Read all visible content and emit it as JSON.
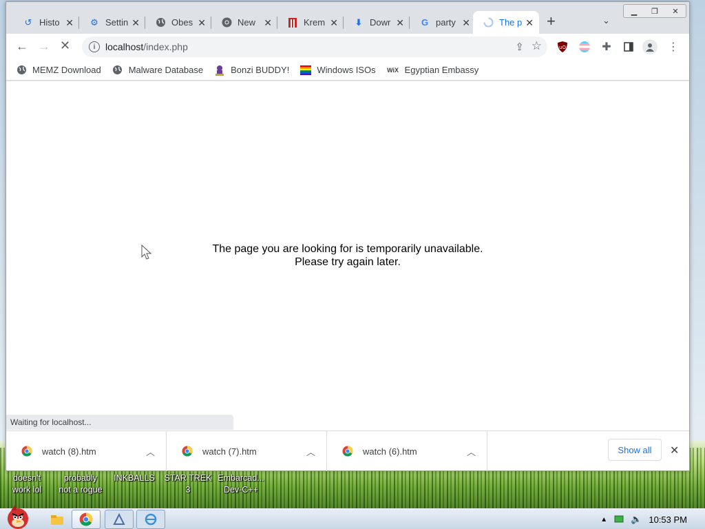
{
  "desktop": {
    "icons": [
      {
        "label": "doesn't\nwork lol"
      },
      {
        "label": "probably\nnot a rogue"
      },
      {
        "label": "INKBALLS"
      },
      {
        "label": "STAR TREK\n3"
      },
      {
        "label": "Embarcad...\nDev-C++"
      }
    ]
  },
  "tabs": [
    {
      "label": "Histo",
      "icon": "history-icon"
    },
    {
      "label": "Settin",
      "icon": "settings-icon"
    },
    {
      "label": "Obes",
      "icon": "globe-icon"
    },
    {
      "label": "New",
      "icon": "chrome-icon"
    },
    {
      "label": "Krem",
      "icon": "kremlin-icon"
    },
    {
      "label": "Dowr",
      "icon": "download-icon"
    },
    {
      "label": "party",
      "icon": "google-icon"
    },
    {
      "label": "The p",
      "icon": "loading-icon",
      "active": true
    }
  ],
  "omnibox": {
    "host": "localhost",
    "path": "/index.php"
  },
  "bookmarks": [
    {
      "label": "MEMZ Download",
      "icon": "globe-icon"
    },
    {
      "label": "Malware Database",
      "icon": "globe-icon"
    },
    {
      "label": "Bonzi BUDDY!",
      "icon": "bonzi-icon"
    },
    {
      "label": "Windows ISOs",
      "icon": "rainbow-flag-icon"
    },
    {
      "label": "Egyptian Embassy",
      "icon": "wix-icon"
    }
  ],
  "wix_text": "WiX",
  "page": {
    "line1": "The page you are looking for is temporarily unavailable.",
    "line2": "Please try again later."
  },
  "status": "Waiting for localhost...",
  "downloads": [
    {
      "name": "watch (8).htm"
    },
    {
      "name": "watch (7).htm"
    },
    {
      "name": "watch (6).htm"
    }
  ],
  "show_all": "Show all",
  "taskbar": {
    "clock": "10:53 PM"
  },
  "colors": {
    "accent": "#1a73e8",
    "tabbar": "#dee1e6",
    "ublock": "#800000"
  }
}
